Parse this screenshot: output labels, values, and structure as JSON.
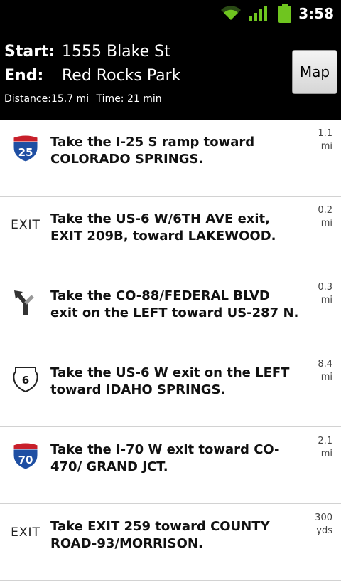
{
  "status_bar": {
    "time": "3:58",
    "icons": [
      "wifi-icon",
      "signal-icon",
      "battery-icon"
    ]
  },
  "header": {
    "start_label": "Start:",
    "start_value": "1555 Blake St",
    "end_label": "End:",
    "end_value": "Red Rocks Park",
    "distance_text": "Distance:15.7 mi",
    "time_text": "Time: 21 min",
    "map_button": "Map"
  },
  "steps": [
    {
      "icon": "interstate-25-icon",
      "shield_text": "25",
      "text": "Take the I-25 S ramp toward COLORADO SPRINGS.",
      "distance": "1.1 mi"
    },
    {
      "icon": "exit-icon",
      "shield_text": "EXIT",
      "text": "Take the US-6 W/6TH AVE exit, EXIT 209B, toward LAKEWOOD.",
      "distance": "0.2 mi"
    },
    {
      "icon": "keep-left-arrow-icon",
      "shield_text": "",
      "text": "Take the CO-88/FEDERAL BLVD exit on the LEFT toward US-287 N.",
      "distance": "0.3 mi"
    },
    {
      "icon": "us-route-6-icon",
      "shield_text": "6",
      "text": "Take the US-6 W exit on the LEFT toward IDAHO SPRINGS.",
      "distance": "8.4 mi"
    },
    {
      "icon": "interstate-70-icon",
      "shield_text": "70",
      "text": "Take the I-70 W exit toward CO-470/ GRAND JCT.",
      "distance": "2.1 mi"
    },
    {
      "icon": "exit-icon",
      "shield_text": "EXIT",
      "text": "Take EXIT 259 toward COUNTY ROAD-93/MORRISON.",
      "distance": "300 yds"
    }
  ],
  "colors": {
    "interstate_blue": "#1f4fa3",
    "interstate_red": "#c8202b",
    "status_green": "#6fc51f"
  }
}
